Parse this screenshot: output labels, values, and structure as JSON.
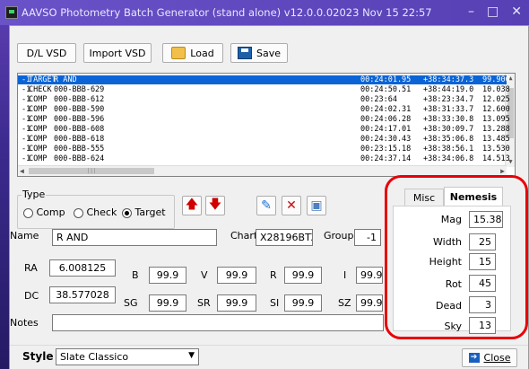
{
  "window": {
    "title": "AAVSO Photometry Batch Generator (stand alone)  v12.0.0.02023 Nov 15 22:57",
    "min": "–",
    "max": "□",
    "close": "✕"
  },
  "toolbar": {
    "dl_vsd": "D/L VSD",
    "import_vsd": "Import VSD",
    "load": "Load",
    "save": "Save"
  },
  "list": {
    "rows": [
      [
        "-1",
        "TARGET",
        "R AND",
        "00:24:01.95",
        "+38:34:37.3",
        "99.900"
      ],
      [
        "-1",
        "CHECK",
        "000-BBB-629",
        "00:24:50.51",
        "+38:44:19.0",
        "10.038"
      ],
      [
        "-1",
        "COMP",
        "000-BBB-612",
        "00:23:64",
        "+38:23:34.7",
        "12.025"
      ],
      [
        "-1",
        "COMP",
        "000-BBB-590",
        "00:24:02.31",
        "+38:31:33.7",
        "12.600"
      ],
      [
        "-1",
        "COMP",
        "000-BBB-596",
        "00:24:06.28",
        "+38:33:30.8",
        "13.095"
      ],
      [
        "-1",
        "COMP",
        "000-BBB-608",
        "00:24:17.01",
        "+38:30:09.7",
        "13.288"
      ],
      [
        "-1",
        "COMP",
        "000-BBB-618",
        "00:24:30.43",
        "+38:35:06.8",
        "13.485"
      ],
      [
        "-1",
        "COMP",
        "000-BBB-555",
        "00:23:15.18",
        "+38:38:56.1",
        "13.530"
      ],
      [
        "-1",
        "COMP",
        "000-BBB-624",
        "00:24:37.14",
        "+38:34:06.8",
        "14.513"
      ]
    ],
    "hscroll_grip": "|||"
  },
  "type_group": {
    "legend": "Type",
    "comp": "Comp",
    "check": "Check",
    "target": "Target",
    "selected": "Target"
  },
  "form": {
    "name_label": "Name",
    "name_value": "R AND",
    "chart_label": "Chart",
    "chart_value": "X28196BTZ",
    "group_label": "Group",
    "group_value": "-1",
    "ra_label": "RA",
    "ra_value": "6.008125",
    "dc_label": "DC",
    "dc_value": "38.577028",
    "b_label": "B",
    "b_value": "99.9",
    "v_label": "V",
    "v_value": "99.9",
    "r_label": "R",
    "r_value": "99.9",
    "i_label": "I",
    "i_value": "99.9",
    "sg_label": "SG",
    "sg_value": "99.9",
    "sr_label": "SR",
    "sr_value": "99.9",
    "si_label": "SI",
    "si_value": "99.9",
    "sz_label": "SZ",
    "sz_value": "99.9",
    "notes_label": "Notes",
    "notes_value": ""
  },
  "tabs": {
    "misc": "Misc",
    "nemesis": "Nemesis",
    "active": "Nemesis"
  },
  "nemesis": {
    "mag_label": "Mag",
    "mag_value": "15.38",
    "width_label": "Width",
    "width_value": "25",
    "height_label": "Height",
    "height_value": "15",
    "rot_label": "Rot",
    "rot_value": "45",
    "dead_label": "Dead",
    "dead_value": "3",
    "sky_label": "Sky",
    "sky_value": "13"
  },
  "footer": {
    "style_label": "Style",
    "style_value": "Slate Classico",
    "close": "Close"
  },
  "colors": {
    "selection": "#0a64d6",
    "highlight": "#e8000a",
    "title_bar": "#6a52c8"
  }
}
